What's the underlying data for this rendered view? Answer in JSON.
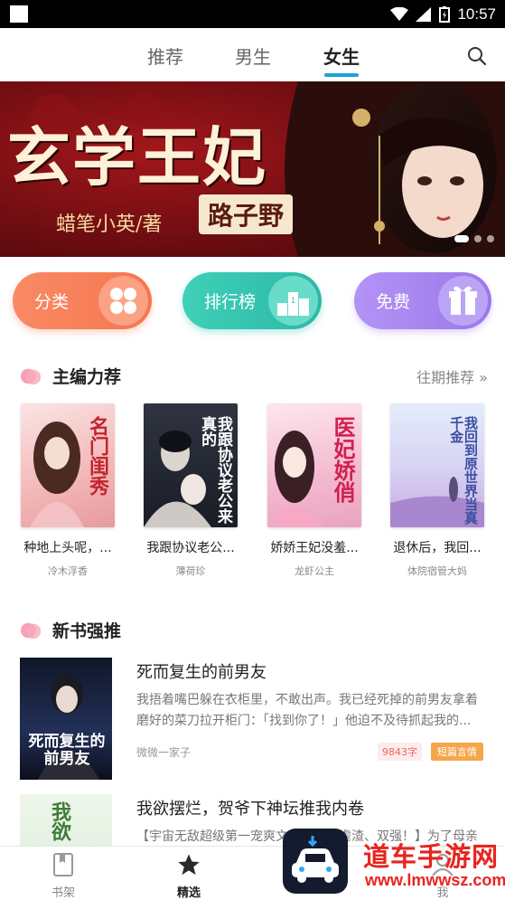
{
  "status_bar": {
    "time": "10:57"
  },
  "top_tabs": [
    {
      "label": "推荐"
    },
    {
      "label": "男生"
    },
    {
      "label": "女生",
      "active": true
    }
  ],
  "banner": {
    "title": "玄学王妃",
    "author": "蜡笔小英/著",
    "subtitle": "路子野",
    "page_count": 3,
    "active_page": 1
  },
  "quick_actions": [
    {
      "label": "分类",
      "icon": "grid-icon",
      "color": "#f7845c"
    },
    {
      "label": "排行榜",
      "icon": "podium-icon",
      "color": "#35c6b1"
    },
    {
      "label": "免费",
      "icon": "gift-icon",
      "color": "#a783ef"
    }
  ],
  "editor_picks": {
    "title": "主编力荐",
    "more_label": "往期推荐",
    "books": [
      {
        "title": "种地上头呢，...",
        "author": "冷木浮香",
        "cover_text": "名门闺秀"
      },
      {
        "title": "我跟协议老公...",
        "author": "薄荷珍",
        "cover_text": "我跟协议老公来真的"
      },
      {
        "title": "娇娇王妃没羞...",
        "author": "龙虾公主",
        "cover_text": "医妃娇俏"
      },
      {
        "title": "退休后，我回...",
        "author": "体院宿管大妈",
        "cover_text": "我回到原世界当真千金"
      }
    ]
  },
  "new_books": {
    "title": "新书强推",
    "items": [
      {
        "title": "死而复生的前男友",
        "desc": "我捂着嘴巴躲在衣柜里，不敢出声。我已经死掉的前男友拿着磨好的菜刀拉开柜门：「找到你了！」他迫不及待抓起我的...",
        "author": "微微一家子",
        "words": "9843字",
        "tag": "短篇言情",
        "cover_text": "死而复生的前男友"
      },
      {
        "title": "我欲摆烂，贺爷下神坛推我内卷",
        "desc": "【宇宙无敌超级第一宠爽文、打脸、虐渣、双强！】为了母亲",
        "cover_text": "我欲"
      }
    ]
  },
  "bottom_nav": [
    {
      "label": "书架",
      "icon": "bookshelf-icon"
    },
    {
      "label": "精选",
      "icon": "star-icon",
      "active": true
    },
    {
      "label": "我",
      "icon": "profile-icon"
    }
  ],
  "watermark": {
    "title": "道车手游网",
    "url": "www.lmwwsz.com"
  },
  "colors": {
    "accent": "#1aa3d6",
    "section_icon": "#f58aa8"
  }
}
